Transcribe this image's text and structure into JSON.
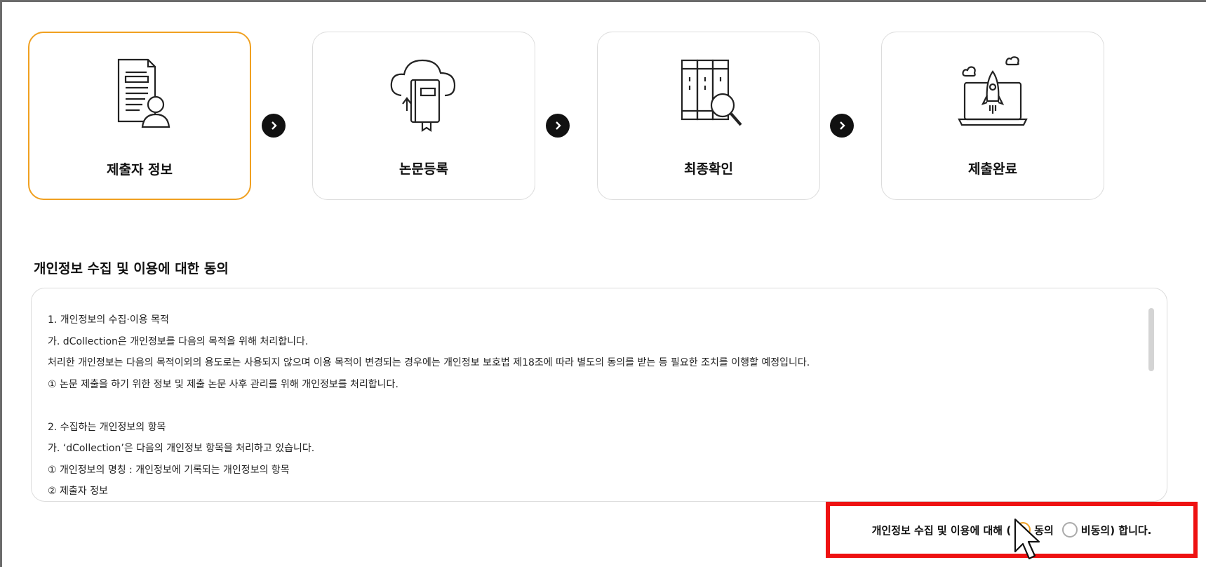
{
  "steps": [
    {
      "label": "제출자 정보",
      "icon": "document-person-icon",
      "active": true
    },
    {
      "label": "논문등록",
      "icon": "cloud-book-upload-icon",
      "active": false
    },
    {
      "label": "최종확인",
      "icon": "binders-magnifier-icon",
      "active": false
    },
    {
      "label": "제출완료",
      "icon": "laptop-rocket-icon",
      "active": false
    }
  ],
  "section_title": "개인정보 수집 및 이용에 대한 동의",
  "terms": {
    "lines": [
      "1. 개인정보의 수집·이용 목적",
      "가. dCollection은 개인정보를 다음의 목적을 위해 처리합니다.",
      "처리한 개인정보는 다음의 목적이외의 용도로는 사용되지 않으며 이용 목적이 변경되는 경우에는 개인정보 보호법 제18조에 따라 별도의 동의를 받는 등 필요한 조치를 이행할 예정입니다.",
      "① 논문 제출을 하기 위한 정보 및 제출 논문 사후 관리를 위해 개인정보를 처리합니다.",
      "",
      "2. 수집하는 개인정보의 항목",
      "가. ‘dCollection’은 다음의 개인정보 항목을 처리하고 있습니다.",
      "① 개인정보의 명칭 : 개인정보에 기록되는 개인정보의 항목",
      "② 제출자 정보"
    ]
  },
  "consent": {
    "prefix": "개인정보 수집 및 이용에 대해 (",
    "agree_label": "동의",
    "disagree_label": "비동의",
    "suffix": ") 합니다.",
    "selected": "agree"
  },
  "colors": {
    "accent": "#f0a020",
    "highlight_box": "#ee1111",
    "arrow": "#111111"
  }
}
